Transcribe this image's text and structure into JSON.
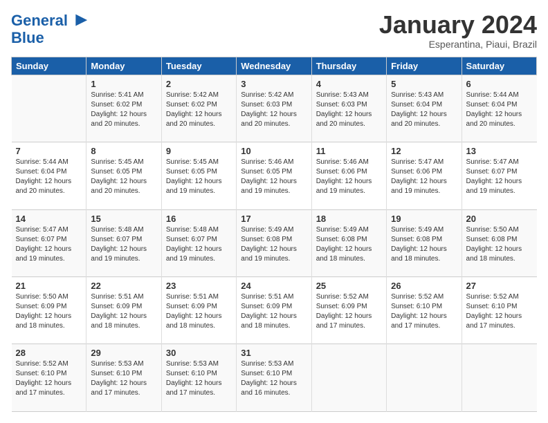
{
  "header": {
    "logo_line1": "General",
    "logo_line2": "Blue",
    "month_title": "January 2024",
    "location": "Esperantina, Piaui, Brazil"
  },
  "days_of_week": [
    "Sunday",
    "Monday",
    "Tuesday",
    "Wednesday",
    "Thursday",
    "Friday",
    "Saturday"
  ],
  "weeks": [
    [
      {
        "day": "",
        "info": ""
      },
      {
        "day": "1",
        "info": "Sunrise: 5:41 AM\nSunset: 6:02 PM\nDaylight: 12 hours\nand 20 minutes."
      },
      {
        "day": "2",
        "info": "Sunrise: 5:42 AM\nSunset: 6:02 PM\nDaylight: 12 hours\nand 20 minutes."
      },
      {
        "day": "3",
        "info": "Sunrise: 5:42 AM\nSunset: 6:03 PM\nDaylight: 12 hours\nand 20 minutes."
      },
      {
        "day": "4",
        "info": "Sunrise: 5:43 AM\nSunset: 6:03 PM\nDaylight: 12 hours\nand 20 minutes."
      },
      {
        "day": "5",
        "info": "Sunrise: 5:43 AM\nSunset: 6:04 PM\nDaylight: 12 hours\nand 20 minutes."
      },
      {
        "day": "6",
        "info": "Sunrise: 5:44 AM\nSunset: 6:04 PM\nDaylight: 12 hours\nand 20 minutes."
      }
    ],
    [
      {
        "day": "7",
        "info": "Sunrise: 5:44 AM\nSunset: 6:04 PM\nDaylight: 12 hours\nand 20 minutes."
      },
      {
        "day": "8",
        "info": "Sunrise: 5:45 AM\nSunset: 6:05 PM\nDaylight: 12 hours\nand 20 minutes."
      },
      {
        "day": "9",
        "info": "Sunrise: 5:45 AM\nSunset: 6:05 PM\nDaylight: 12 hours\nand 19 minutes."
      },
      {
        "day": "10",
        "info": "Sunrise: 5:46 AM\nSunset: 6:05 PM\nDaylight: 12 hours\nand 19 minutes."
      },
      {
        "day": "11",
        "info": "Sunrise: 5:46 AM\nSunset: 6:06 PM\nDaylight: 12 hours\nand 19 minutes."
      },
      {
        "day": "12",
        "info": "Sunrise: 5:47 AM\nSunset: 6:06 PM\nDaylight: 12 hours\nand 19 minutes."
      },
      {
        "day": "13",
        "info": "Sunrise: 5:47 AM\nSunset: 6:07 PM\nDaylight: 12 hours\nand 19 minutes."
      }
    ],
    [
      {
        "day": "14",
        "info": "Sunrise: 5:47 AM\nSunset: 6:07 PM\nDaylight: 12 hours\nand 19 minutes."
      },
      {
        "day": "15",
        "info": "Sunrise: 5:48 AM\nSunset: 6:07 PM\nDaylight: 12 hours\nand 19 minutes."
      },
      {
        "day": "16",
        "info": "Sunrise: 5:48 AM\nSunset: 6:07 PM\nDaylight: 12 hours\nand 19 minutes."
      },
      {
        "day": "17",
        "info": "Sunrise: 5:49 AM\nSunset: 6:08 PM\nDaylight: 12 hours\nand 19 minutes."
      },
      {
        "day": "18",
        "info": "Sunrise: 5:49 AM\nSunset: 6:08 PM\nDaylight: 12 hours\nand 18 minutes."
      },
      {
        "day": "19",
        "info": "Sunrise: 5:49 AM\nSunset: 6:08 PM\nDaylight: 12 hours\nand 18 minutes."
      },
      {
        "day": "20",
        "info": "Sunrise: 5:50 AM\nSunset: 6:08 PM\nDaylight: 12 hours\nand 18 minutes."
      }
    ],
    [
      {
        "day": "21",
        "info": "Sunrise: 5:50 AM\nSunset: 6:09 PM\nDaylight: 12 hours\nand 18 minutes."
      },
      {
        "day": "22",
        "info": "Sunrise: 5:51 AM\nSunset: 6:09 PM\nDaylight: 12 hours\nand 18 minutes."
      },
      {
        "day": "23",
        "info": "Sunrise: 5:51 AM\nSunset: 6:09 PM\nDaylight: 12 hours\nand 18 minutes."
      },
      {
        "day": "24",
        "info": "Sunrise: 5:51 AM\nSunset: 6:09 PM\nDaylight: 12 hours\nand 18 minutes."
      },
      {
        "day": "25",
        "info": "Sunrise: 5:52 AM\nSunset: 6:09 PM\nDaylight: 12 hours\nand 17 minutes."
      },
      {
        "day": "26",
        "info": "Sunrise: 5:52 AM\nSunset: 6:10 PM\nDaylight: 12 hours\nand 17 minutes."
      },
      {
        "day": "27",
        "info": "Sunrise: 5:52 AM\nSunset: 6:10 PM\nDaylight: 12 hours\nand 17 minutes."
      }
    ],
    [
      {
        "day": "28",
        "info": "Sunrise: 5:52 AM\nSunset: 6:10 PM\nDaylight: 12 hours\nand 17 minutes."
      },
      {
        "day": "29",
        "info": "Sunrise: 5:53 AM\nSunset: 6:10 PM\nDaylight: 12 hours\nand 17 minutes."
      },
      {
        "day": "30",
        "info": "Sunrise: 5:53 AM\nSunset: 6:10 PM\nDaylight: 12 hours\nand 17 minutes."
      },
      {
        "day": "31",
        "info": "Sunrise: 5:53 AM\nSunset: 6:10 PM\nDaylight: 12 hours\nand 16 minutes."
      },
      {
        "day": "",
        "info": ""
      },
      {
        "day": "",
        "info": ""
      },
      {
        "day": "",
        "info": ""
      }
    ]
  ]
}
